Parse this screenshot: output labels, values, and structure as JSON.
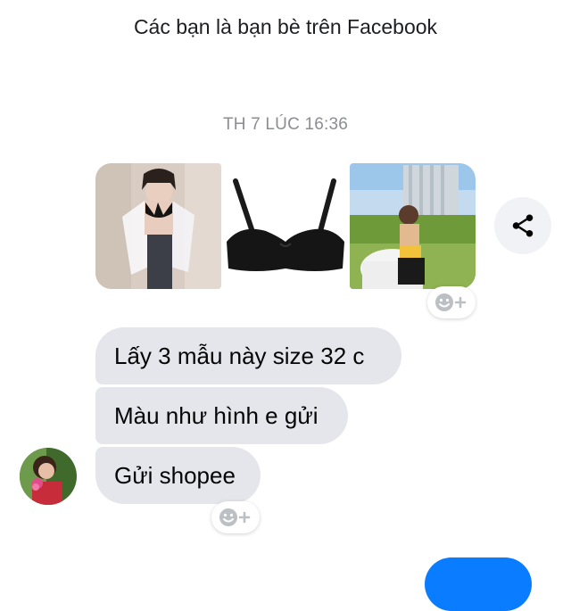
{
  "header": {
    "friends_text": "Các bạn là bạn bè trên Facebook"
  },
  "thread": {
    "timestamp": "TH 7 LÚC 16:36",
    "photos": [
      {
        "icon": "photo-woman-white-shirt-black-bra"
      },
      {
        "icon": "photo-black-strapless-bra"
      },
      {
        "icon": "photo-woman-outdoor-yellow-top"
      }
    ],
    "messages": [
      {
        "text": "Lấy 3 mẫu này size 32 c"
      },
      {
        "text": "Màu như hình e gửi"
      },
      {
        "text": "Gửi shopee"
      }
    ]
  },
  "icons": {
    "share": "share-icon",
    "reaction": "add-reaction-icon",
    "avatar": "contact-avatar"
  },
  "colors": {
    "bubble": "#e4e6eb",
    "timestamp": "#8a8d91",
    "sent_bubble": "#0a7cff",
    "share_bg": "#f0f2f5"
  }
}
